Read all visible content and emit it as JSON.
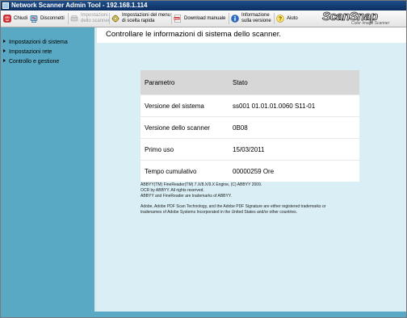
{
  "window": {
    "title": "Network Scanner Admin Tool  -  192.168.1.114"
  },
  "toolbar": {
    "chiudi": "Chiudi",
    "disconnetti": "Disconnetti",
    "impostazioni_scanner": "Impostazioni\ndello scanner",
    "impostazioni_menu": "Impostazioni del menu\ndi scelta rapida",
    "download": "Download manuale",
    "informazione": "Informazione\nsulla versione",
    "aiuto": "Aiuto"
  },
  "brand": {
    "name": "ScanSnap",
    "subtitle": "Color Image Scanner"
  },
  "sidebar": {
    "items": [
      {
        "label": "Impostazioni di sistema"
      },
      {
        "label": "Impostazioni rete"
      },
      {
        "label": "Controllo e gestione"
      }
    ]
  },
  "main": {
    "title": "Controllare le informazioni di sistema dello scanner.",
    "table": {
      "headers": [
        "Parametro",
        "Stato"
      ],
      "rows": [
        [
          "Versione del sistema",
          "ss001 01.01.01.0060 S11-01"
        ],
        [
          "Versione dello scanner",
          "0B08"
        ],
        [
          "Primo uso",
          "15/03/2011"
        ],
        [
          "Tempo cumulativo",
          "00000259 Ore"
        ]
      ]
    },
    "legal": {
      "line1": "ABBYY(TM) FineReader(TM) 7.X/8.X/9.X Engine, (C) ABBYY 2009.",
      "line2": "OCR by ABBYY. All rights reserved.",
      "line3": "ABBYY and FineReader are trademarks of ABBYY.",
      "line4": "Adobe, Adobe PDF Scan Technology, and the Adobe PDF Signature are either registered trademarks or",
      "line5": "tradenames of Adobe Systems  Incorporated in the United States and/or other countries."
    }
  },
  "colors": {
    "sidebar": "#5aa9c4",
    "content_bg": "#d9eff5",
    "titlebar": "#1d4e8a",
    "table_header": "#d7d7d7"
  }
}
